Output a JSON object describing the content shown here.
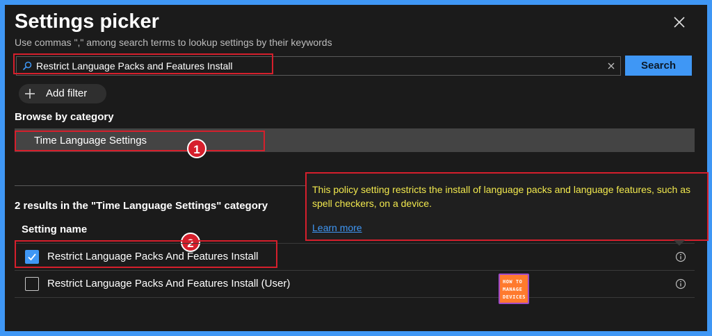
{
  "dialog": {
    "title": "Settings picker",
    "subtitle": "Use commas \",\" among search terms to lookup settings by their keywords",
    "close_icon": "close-icon"
  },
  "search": {
    "value": "Restrict Language Packs and Features Install",
    "button_label": "Search",
    "icon": "search-icon"
  },
  "filter": {
    "add_label": "Add filter"
  },
  "browse": {
    "heading": "Browse by category",
    "category_label": "Time Language Settings",
    "callout": "1"
  },
  "results": {
    "heading": "2 results in the \"Time Language Settings\" category",
    "column_header": "Setting name",
    "callout": "2",
    "rows": [
      {
        "label": "Restrict Language Packs And Features Install",
        "checked": true
      },
      {
        "label": "Restrict Language Packs And Features Install (User)",
        "checked": false
      }
    ]
  },
  "tooltip": {
    "text": "This policy setting restricts the install of language packs and language features, such as spell checkers, on a device.",
    "link": "Learn more"
  },
  "watermark": {
    "line1": "HOW TO",
    "line2": "MANAGE",
    "line3": "DEVICES"
  },
  "colors": {
    "accent": "#3f97f5",
    "highlight": "#d61f2c",
    "tooltip_text": "#f2e94e",
    "background": "#1b1b1b"
  }
}
